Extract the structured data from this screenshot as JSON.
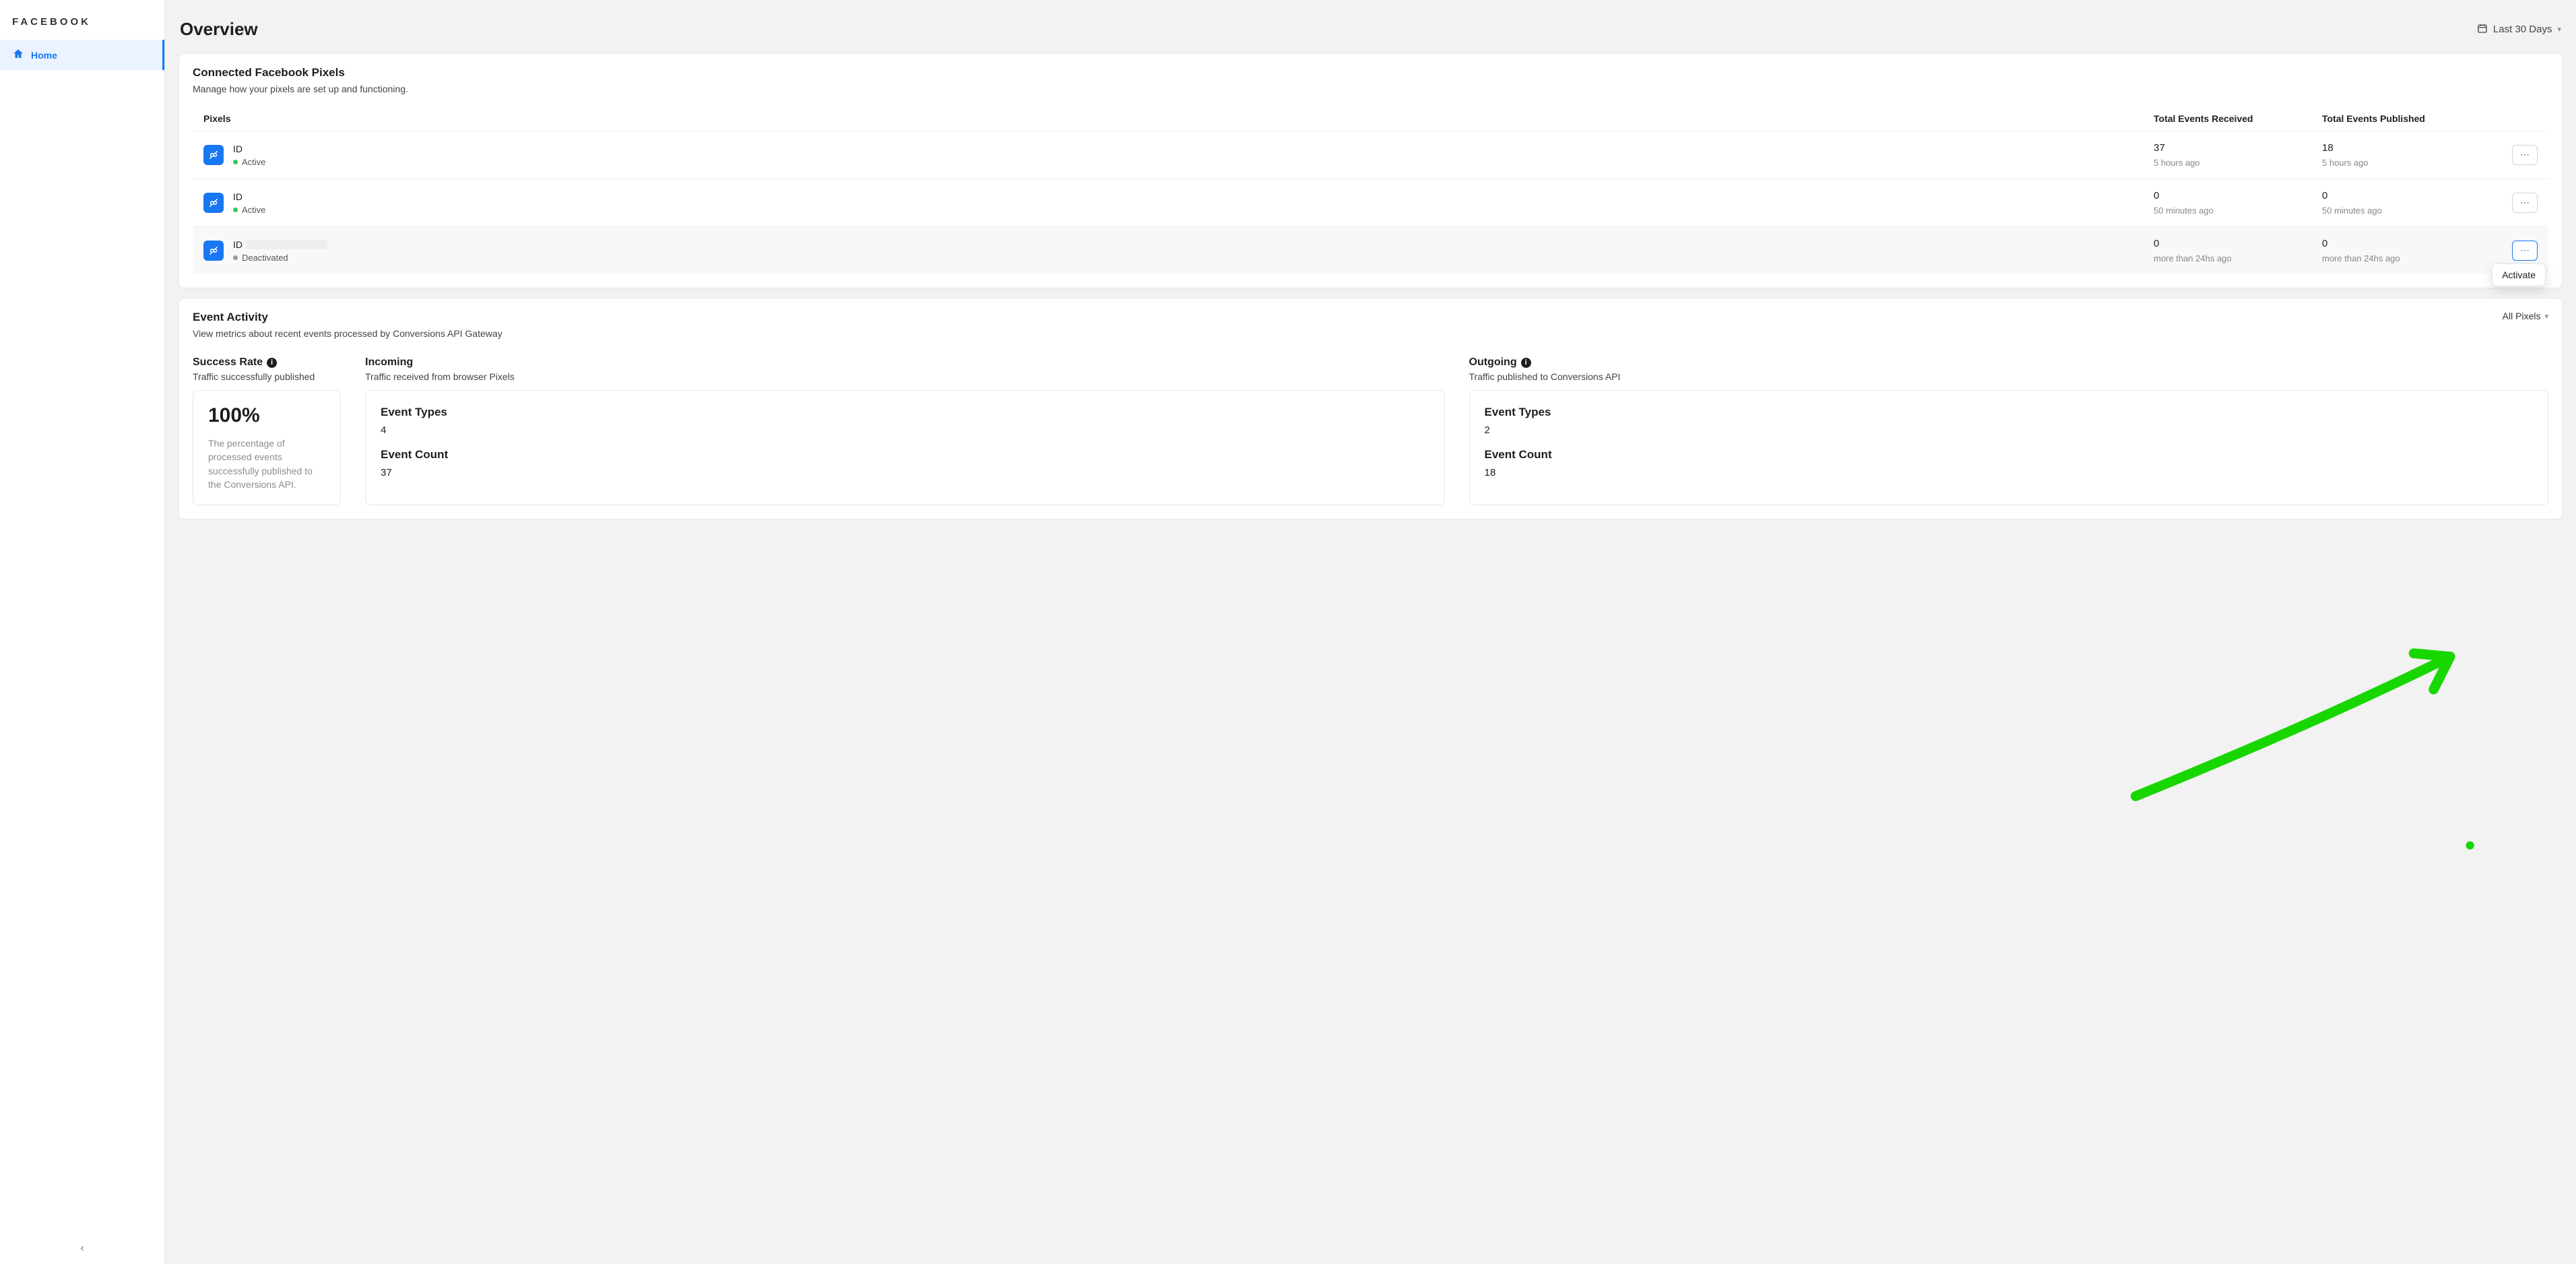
{
  "brand": "FACEBOOK",
  "sidebar": {
    "items": [
      {
        "label": "Home"
      }
    ]
  },
  "header": {
    "title": "Overview",
    "date_range": "Last 30 Days"
  },
  "pixels_card": {
    "title": "Connected Facebook Pixels",
    "subtitle": "Manage how your pixels are set up and functioning.",
    "columns": {
      "c0": "Pixels",
      "c1": "Total Events Received",
      "c2": "Total Events Published"
    },
    "rows": [
      {
        "id_label": "ID",
        "status": "Active",
        "status_kind": "green",
        "received": "37",
        "received_ago": "5 hours ago",
        "published": "18",
        "published_ago": "5 hours ago",
        "redacted": false
      },
      {
        "id_label": "ID",
        "status": "Active",
        "status_kind": "green",
        "received": "0",
        "received_ago": "50 minutes ago",
        "published": "0",
        "published_ago": "50 minutes ago",
        "redacted": false
      },
      {
        "id_label": "ID",
        "status": "Deactivated",
        "status_kind": "gray",
        "received": "0",
        "received_ago": "more than 24hs ago",
        "published": "0",
        "published_ago": "more than 24hs ago",
        "redacted": true
      }
    ],
    "dropdown_action": "Activate"
  },
  "activity_card": {
    "title": "Event Activity",
    "subtitle": "View metrics about recent events processed by Conversions API Gateway",
    "filter_label": "All Pixels",
    "success": {
      "title": "Success Rate",
      "sub": "Traffic successfully published",
      "pct": "100%",
      "desc": "The percentage of processed events successfully published to the Conversions API."
    },
    "incoming": {
      "title": "Incoming",
      "sub": "Traffic received from browser Pixels",
      "types_label": "Event Types",
      "types_val": "4",
      "count_label": "Event Count",
      "count_val": "37"
    },
    "outgoing": {
      "title": "Outgoing",
      "sub": "Traffic published to Conversions API",
      "types_label": "Event Types",
      "types_val": "2",
      "count_label": "Event Count",
      "count_val": "18"
    }
  }
}
